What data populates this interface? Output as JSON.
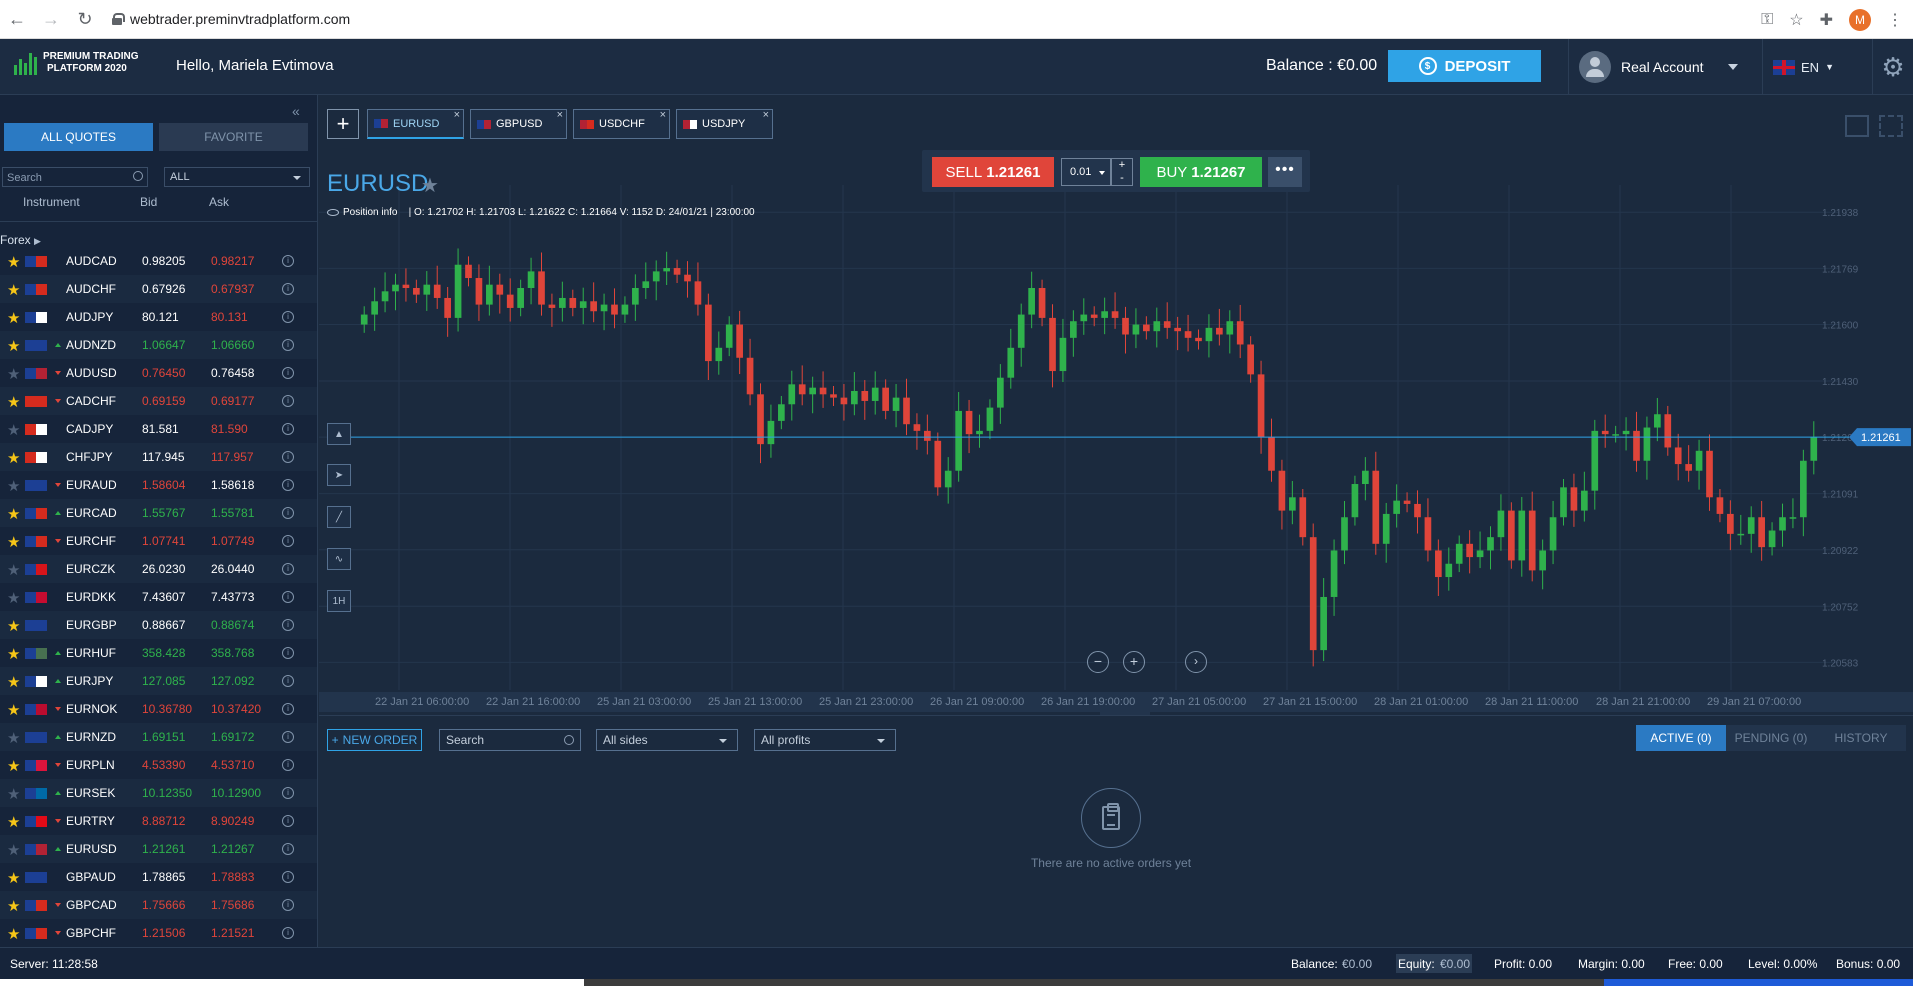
{
  "browser": {
    "url": "webtrader.preminvtradplatform.com",
    "profile_initial": "M"
  },
  "header": {
    "logo_line1": "PREMIUM TRADING",
    "logo_line2": "PLATFORM 2020",
    "greeting": "Hello, Mariela Evtimova",
    "balance": "Balance : €0.00",
    "deposit_label": "DEPOSIT",
    "account_label": "Real Account",
    "language": "EN"
  },
  "sidebar": {
    "tab_all": "ALL QUOTES",
    "tab_favorite": "FAVORITE",
    "search_placeholder": "Search",
    "filter_value": "ALL",
    "col_instrument": "Instrument",
    "col_bid": "Bid",
    "col_ask": "Ask",
    "group": "Forex",
    "quotes": [
      {
        "symbol": "AUDCAD",
        "bid": "0.98205",
        "ask": "0.98217",
        "fav": true,
        "dir": "none",
        "color": "white-red",
        "flags": [
          "#1c3f94",
          "#d52b1e"
        ]
      },
      {
        "symbol": "AUDCHF",
        "bid": "0.67926",
        "ask": "0.67937",
        "fav": true,
        "dir": "none",
        "color": "white-red",
        "flags": [
          "#1c3f94",
          "#d52b1e"
        ]
      },
      {
        "symbol": "AUDJPY",
        "bid": "80.121",
        "ask": "80.131",
        "fav": true,
        "dir": "none",
        "color": "white-red",
        "flags": [
          "#1c3f94",
          "#ffffff"
        ]
      },
      {
        "symbol": "AUDNZD",
        "bid": "1.06647",
        "ask": "1.06660",
        "fav": true,
        "dir": "up",
        "color": "green",
        "flags": [
          "#1c3f94",
          "#1c3f94"
        ]
      },
      {
        "symbol": "AUDUSD",
        "bid": "0.76450",
        "ask": "0.76458",
        "fav": false,
        "dir": "down",
        "color": "red-white",
        "flags": [
          "#1c3f94",
          "#b22234"
        ]
      },
      {
        "symbol": "CADCHF",
        "bid": "0.69159",
        "ask": "0.69177",
        "fav": true,
        "dir": "down",
        "color": "red",
        "flags": [
          "#d52b1e",
          "#d52b1e"
        ]
      },
      {
        "symbol": "CADJPY",
        "bid": "81.581",
        "ask": "81.590",
        "fav": false,
        "dir": "none",
        "color": "white-red",
        "flags": [
          "#d52b1e",
          "#ffffff"
        ]
      },
      {
        "symbol": "CHFJPY",
        "bid": "117.945",
        "ask": "117.957",
        "fav": true,
        "dir": "none",
        "color": "white-red",
        "flags": [
          "#d52b1e",
          "#ffffff"
        ]
      },
      {
        "symbol": "EURAUD",
        "bid": "1.58604",
        "ask": "1.58618",
        "fav": false,
        "dir": "down",
        "color": "red-white",
        "flags": [
          "#1c3f94",
          "#1c3f94"
        ]
      },
      {
        "symbol": "EURCAD",
        "bid": "1.55767",
        "ask": "1.55781",
        "fav": true,
        "dir": "up",
        "color": "green",
        "flags": [
          "#1c3f94",
          "#d52b1e"
        ]
      },
      {
        "symbol": "EURCHF",
        "bid": "1.07741",
        "ask": "1.07749",
        "fav": true,
        "dir": "down",
        "color": "red",
        "flags": [
          "#1c3f94",
          "#d52b1e"
        ]
      },
      {
        "symbol": "EURCZK",
        "bid": "26.0230",
        "ask": "26.0440",
        "fav": false,
        "dir": "none",
        "color": "white",
        "flags": [
          "#1c3f94",
          "#d7141a"
        ]
      },
      {
        "symbol": "EURDKK",
        "bid": "7.43607",
        "ask": "7.43773",
        "fav": false,
        "dir": "none",
        "color": "white",
        "flags": [
          "#1c3f94",
          "#c60c30"
        ]
      },
      {
        "symbol": "EURGBP",
        "bid": "0.88667",
        "ask": "0.88674",
        "fav": true,
        "dir": "none",
        "color": "white-green",
        "flags": [
          "#1c3f94",
          "#1c3f94"
        ]
      },
      {
        "symbol": "EURHUF",
        "bid": "358.428",
        "ask": "358.768",
        "fav": true,
        "dir": "up",
        "color": "green",
        "flags": [
          "#1c3f94",
          "#477050"
        ]
      },
      {
        "symbol": "EURJPY",
        "bid": "127.085",
        "ask": "127.092",
        "fav": true,
        "dir": "up",
        "color": "green",
        "flags": [
          "#1c3f94",
          "#ffffff"
        ]
      },
      {
        "symbol": "EURNOK",
        "bid": "10.36780",
        "ask": "10.37420",
        "fav": true,
        "dir": "down",
        "color": "red",
        "flags": [
          "#1c3f94",
          "#ba0c2f"
        ]
      },
      {
        "symbol": "EURNZD",
        "bid": "1.69151",
        "ask": "1.69172",
        "fav": false,
        "dir": "up",
        "color": "green",
        "flags": [
          "#1c3f94",
          "#1c3f94"
        ]
      },
      {
        "symbol": "EURPLN",
        "bid": "4.53390",
        "ask": "4.53710",
        "fav": true,
        "dir": "down",
        "color": "red",
        "flags": [
          "#1c3f94",
          "#dc143c"
        ]
      },
      {
        "symbol": "EURSEK",
        "bid": "10.12350",
        "ask": "10.12900",
        "fav": false,
        "dir": "up",
        "color": "green",
        "flags": [
          "#1c3f94",
          "#006aa7"
        ]
      },
      {
        "symbol": "EURTRY",
        "bid": "8.88712",
        "ask": "8.90249",
        "fav": true,
        "dir": "down",
        "color": "red",
        "flags": [
          "#1c3f94",
          "#e30a17"
        ]
      },
      {
        "symbol": "EURUSD",
        "bid": "1.21261",
        "ask": "1.21267",
        "fav": false,
        "dir": "up",
        "color": "green",
        "flags": [
          "#1c3f94",
          "#b22234"
        ]
      },
      {
        "symbol": "GBPAUD",
        "bid": "1.78865",
        "ask": "1.78883",
        "fav": true,
        "dir": "none",
        "color": "white-red",
        "flags": [
          "#1c3f94",
          "#1c3f94"
        ]
      },
      {
        "symbol": "GBPCAD",
        "bid": "1.75666",
        "ask": "1.75686",
        "fav": true,
        "dir": "down",
        "color": "red",
        "flags": [
          "#1c3f94",
          "#d52b1e"
        ]
      },
      {
        "symbol": "GBPCHF",
        "bid": "1.21506",
        "ask": "1.21521",
        "fav": true,
        "dir": "down",
        "color": "red",
        "flags": [
          "#1c3f94",
          "#d52b1e"
        ]
      }
    ]
  },
  "chart_tabs": [
    {
      "label": "EURUSD",
      "active": true,
      "flags": [
        "#1c3f94",
        "#b22234"
      ]
    },
    {
      "label": "GBPUSD",
      "active": false,
      "flags": [
        "#1c3f94",
        "#b22234"
      ]
    },
    {
      "label": "USDCHF",
      "active": false,
      "flags": [
        "#b22234",
        "#d52b1e"
      ]
    },
    {
      "label": "USDJPY",
      "active": false,
      "flags": [
        "#b22234",
        "#ffffff"
      ]
    }
  ],
  "trade": {
    "sell_label": "SELL",
    "sell_price": "1.21261",
    "buy_label": "BUY",
    "buy_price": "1.21267",
    "lot": "0.01",
    "more": "•••"
  },
  "chart_header": {
    "symbol": "EURUSD",
    "position_info": "Position info",
    "ohlc": "|   O: 1.21702   H: 1.21703   L: 1.21622   C: 1.21664   V: 1152   D: 24/01/21 | 23:00:00"
  },
  "tools": [
    "1H"
  ],
  "chart_data": {
    "type": "candlestick",
    "current_price": "1.21261",
    "y_ticks": [
      "1.21938",
      "1.21769",
      "1.21600",
      "1.21430",
      "1.21261",
      "1.21091",
      "1.20922",
      "1.20752",
      "1.20583"
    ],
    "ylim": [
      1.205,
      1.2202
    ],
    "x_ticks": [
      "22 Jan 21 06:00:00",
      "22 Jan 21 16:00:00",
      "25 Jan 21 03:00:00",
      "25 Jan 21 13:00:00",
      "25 Jan 21 23:00:00",
      "26 Jan 21 09:00:00",
      "26 Jan 21 19:00:00",
      "27 Jan 21 05:00:00",
      "27 Jan 21 15:00:00",
      "28 Jan 21 01:00:00",
      "28 Jan 21 11:00:00",
      "28 Jan 21 21:00:00",
      "29 Jan 21 07:00:00"
    ],
    "closes": [
      1.2163,
      1.2167,
      1.217,
      1.2172,
      1.2171,
      1.2169,
      1.2172,
      1.2168,
      1.2162,
      1.2178,
      1.2174,
      1.2166,
      1.2172,
      1.2169,
      1.2165,
      1.2171,
      1.2176,
      1.2166,
      1.2165,
      1.2168,
      1.2165,
      1.2167,
      1.2164,
      1.2166,
      1.2163,
      1.2166,
      1.2171,
      1.2173,
      1.2176,
      1.2177,
      1.2175,
      1.2173,
      1.2166,
      1.2149,
      1.2153,
      1.216,
      1.215,
      1.2139,
      1.2124,
      1.2131,
      1.2136,
      1.2142,
      1.2139,
      1.2141,
      1.2139,
      1.2138,
      1.2136,
      1.214,
      1.2137,
      1.2141,
      1.2134,
      1.2138,
      1.213,
      1.2128,
      1.2125,
      1.2111,
      1.2116,
      1.2134,
      1.2127,
      1.2128,
      1.2135,
      1.2144,
      1.2153,
      1.2163,
      1.2171,
      1.2162,
      1.2146,
      1.2156,
      1.2161,
      1.2163,
      1.2162,
      1.2164,
      1.2162,
      1.2157,
      1.216,
      1.2158,
      1.2161,
      1.2159,
      1.2158,
      1.2156,
      1.2155,
      1.2159,
      1.2157,
      1.2161,
      1.2154,
      1.2145,
      1.2126,
      1.2116,
      1.2104,
      1.2108,
      1.2096,
      1.2062,
      1.2078,
      1.2092,
      1.2102,
      1.2112,
      1.2116,
      1.2094,
      1.2103,
      1.2107,
      1.2106,
      1.2102,
      1.2092,
      1.2084,
      1.2088,
      1.2094,
      1.209,
      1.2092,
      1.2096,
      1.2104,
      1.2089,
      1.2104,
      1.2086,
      1.2092,
      1.2102,
      1.2111,
      1.2104,
      1.211,
      1.2128,
      1.2127,
      1.2127,
      1.2128,
      1.2119,
      1.2129,
      1.2133,
      1.2123,
      1.2118,
      1.2116,
      1.2122,
      1.2108,
      1.2103,
      1.2097,
      1.2097,
      1.2102,
      1.2093,
      1.2098,
      1.2102,
      1.2102,
      1.2119,
      1.2126
    ]
  },
  "zoom": {
    "out": "−",
    "in": "+",
    "next": "›"
  },
  "orders": {
    "new_order": "NEW ORDER",
    "search_placeholder": "Search",
    "sides": "All sides",
    "profits": "All profits",
    "tab_active": "ACTIVE (0)",
    "tab_pending": "PENDING (0)",
    "tab_history": "HISTORY",
    "empty_text": "There are no active orders yet"
  },
  "status": {
    "server": "Server: 11:28:58",
    "balance_label": "Balance:",
    "balance_value": "€0.00",
    "equity_label": "Equity:",
    "equity_value": "€0.00",
    "profit": "Profit: 0.00",
    "margin": "Margin: 0.00",
    "free": "Free: 0.00",
    "level": "Level: 0.00%",
    "bonus": "Bonus: 0.00"
  }
}
